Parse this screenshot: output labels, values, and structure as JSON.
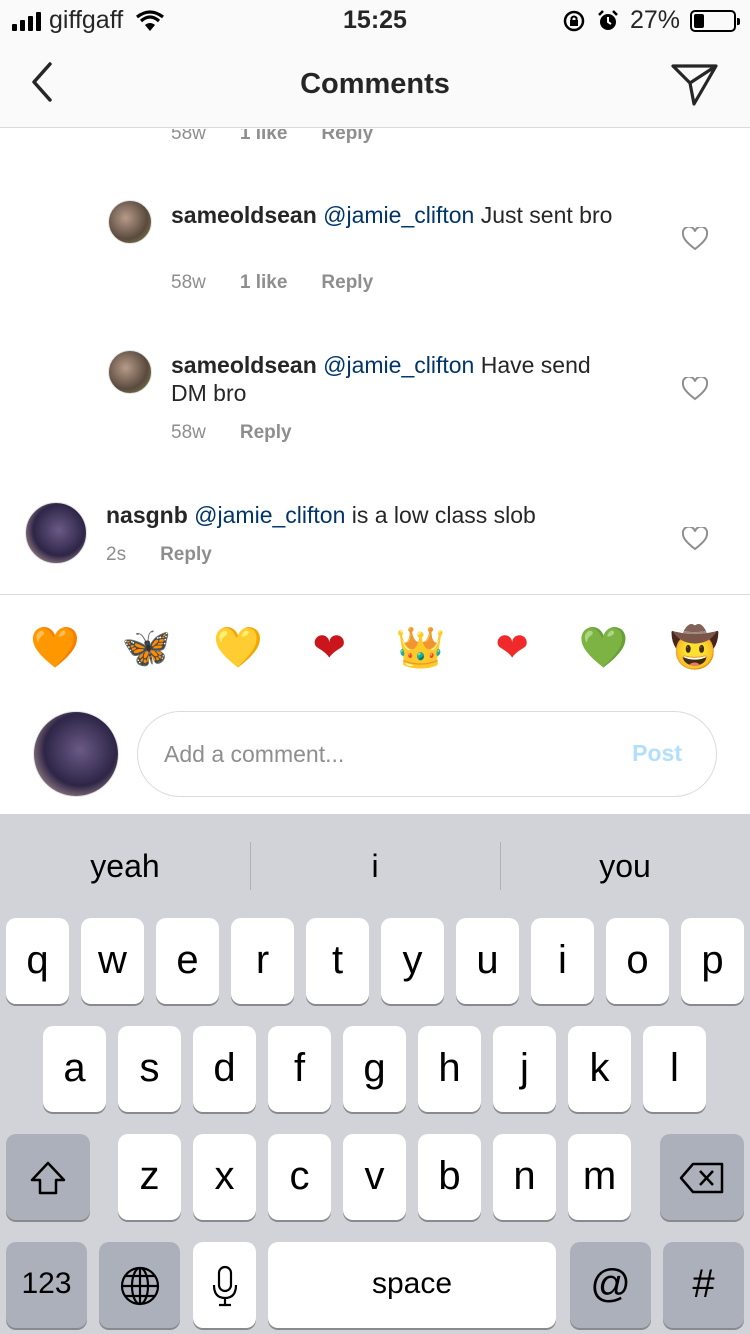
{
  "status_bar": {
    "carrier": "giffgaff",
    "time": "15:25",
    "battery_text": "27%",
    "battery_level": 0.27
  },
  "header": {
    "title": "Comments"
  },
  "comments": {
    "partial": {
      "age": "58w",
      "likes": "1 like",
      "reply": "Reply"
    },
    "items": [
      {
        "user": "sameoldsean",
        "mention": "@jamie_clifton",
        "text": " Just sent bro",
        "age": "58w",
        "likes": "1 like",
        "reply": "Reply"
      },
      {
        "user": "sameoldsean",
        "mention": "@jamie_clifton",
        "text": " Have send DM bro",
        "age": "58w",
        "reply": "Reply"
      },
      {
        "user": "nasgnb",
        "mention": "@jamie_clifton",
        "text": " is a low class slob",
        "age": "2s",
        "reply": "Reply"
      }
    ]
  },
  "emoji_bar": [
    "🧡",
    "🦋",
    "💛",
    "❤",
    "👑",
    "❤",
    "💚",
    "🤠"
  ],
  "compose": {
    "placeholder": "Add a comment...",
    "post_label": "Post"
  },
  "keyboard": {
    "suggestions": [
      "yeah",
      "i",
      "you"
    ],
    "row1": [
      "q",
      "w",
      "e",
      "r",
      "t",
      "y",
      "u",
      "i",
      "o",
      "p"
    ],
    "row2": [
      "a",
      "s",
      "d",
      "f",
      "g",
      "h",
      "j",
      "k",
      "l"
    ],
    "row3": [
      "z",
      "x",
      "c",
      "v",
      "b",
      "n",
      "m"
    ],
    "numbers_label": "123",
    "space_label": "space",
    "at_label": "@",
    "hash_label": "#"
  }
}
